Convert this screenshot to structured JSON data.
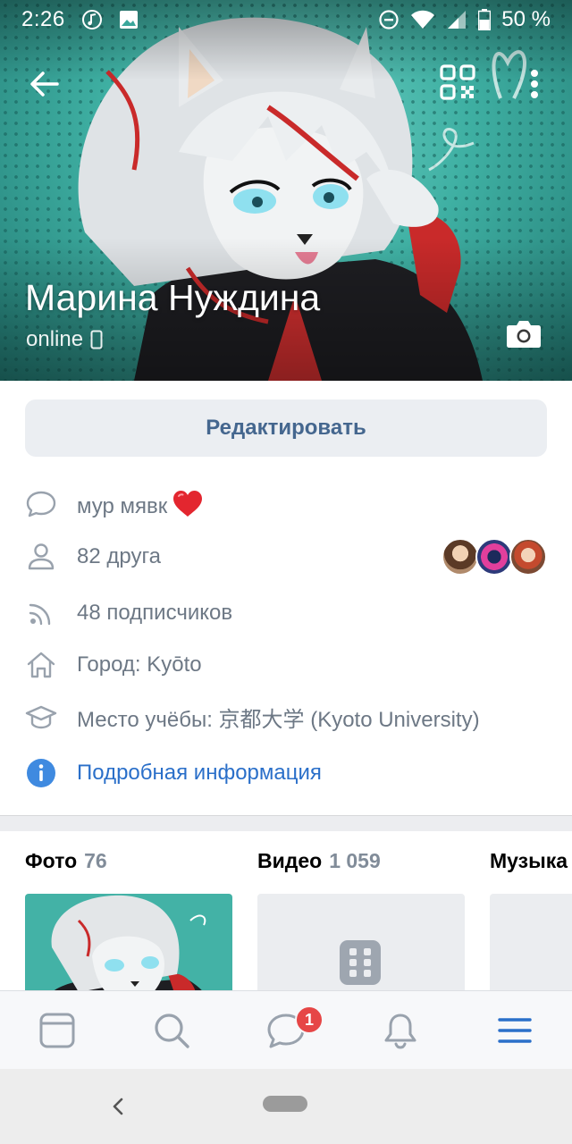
{
  "status_bar": {
    "time": "2:26",
    "battery": "50 %"
  },
  "profile": {
    "name": "Марина Нуждина",
    "presence": "online",
    "edit_label": "Редактировать"
  },
  "info_rows": {
    "status_text": "мур мявк",
    "friends": "82 друга",
    "followers": "48 подписчиков",
    "city": "Город: Kyōto",
    "education": "Место учёбы: 京都大学 (Kyoto University)",
    "details_link": "Подробная информация"
  },
  "media": {
    "photo": {
      "label": "Фото",
      "count": "76"
    },
    "video": {
      "label": "Видео",
      "count": "1 059"
    },
    "music": {
      "label": "Музыка"
    }
  },
  "tabbar": {
    "items": [
      "feed-icon",
      "search-icon",
      "messages-icon",
      "notifications-icon",
      "menu-icon"
    ],
    "messages_badge": "1"
  },
  "colors": {
    "accent": "#2a6fc9",
    "button_text": "#45678f",
    "button_bg": "#ebeef2",
    "secondary_text": "#6d7885",
    "badge": "#e64646",
    "cover": "#3aa79b"
  }
}
